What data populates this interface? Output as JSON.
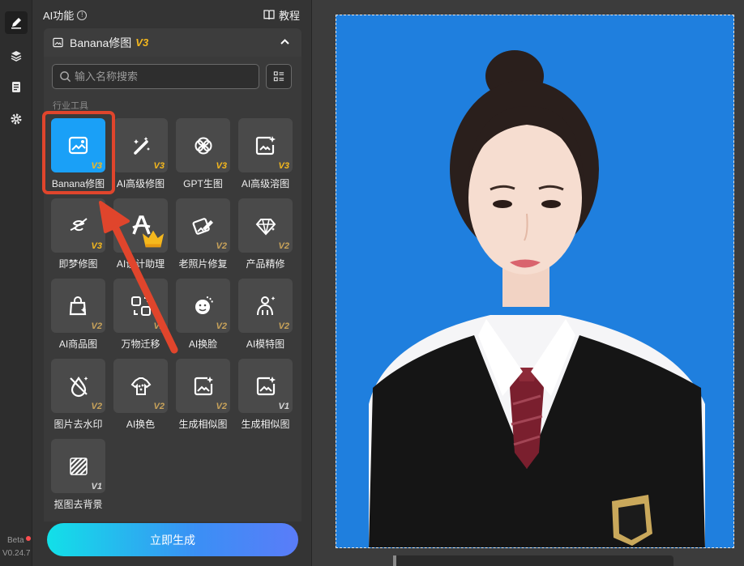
{
  "toolbar": {
    "icons": [
      "pencil-icon",
      "layers-icon",
      "clipboard-icon",
      "gear-icon"
    ],
    "beta_label": "Beta",
    "version": "V0.24.7"
  },
  "panel": {
    "ai_title": "AI功能",
    "tutorial_label": "教程",
    "dropdown": {
      "title": "Banana修图",
      "version": "V3"
    },
    "search_placeholder": "输入名称搜索",
    "section_title": "行业工具",
    "tools": [
      {
        "label": "Banana修图",
        "version": "V3",
        "icon": "image-edit-icon",
        "selected": true
      },
      {
        "label": "AI高级修图",
        "version": "V3",
        "icon": "magic-wand-icon"
      },
      {
        "label": "GPT生图",
        "version": "V3",
        "icon": "gpt-knot-icon"
      },
      {
        "label": "AI高级溶图",
        "version": "V3",
        "icon": "image-sparkle-icon"
      },
      {
        "label": "即梦修图",
        "version": "V3",
        "icon": "jimeng-icon"
      },
      {
        "label": "AI设计助理",
        "version": "",
        "icon": "letter-a-icon",
        "badge": "crown-icon"
      },
      {
        "label": "老照片修复",
        "version": "V2",
        "icon": "bandage-image-icon"
      },
      {
        "label": "产品精修",
        "version": "V2",
        "icon": "gem-icon"
      },
      {
        "label": "AI商品图",
        "version": "V2",
        "icon": "shopping-bag-icon"
      },
      {
        "label": "万物迁移",
        "version": "V2",
        "icon": "transfer-icon"
      },
      {
        "label": "AI换脸",
        "version": "V2",
        "icon": "face-swap-icon"
      },
      {
        "label": "AI模特图",
        "version": "V2",
        "icon": "model-person-icon"
      },
      {
        "label": "图片去水印",
        "version": "V2",
        "icon": "no-watermark-icon"
      },
      {
        "label": "AI换色",
        "version": "V2",
        "icon": "palette-shirt-icon"
      },
      {
        "label": "生成相似图",
        "version": "V2",
        "icon": "similar-image-icon"
      },
      {
        "label": "生成相似图",
        "version": "V1",
        "icon": "similar-image-icon"
      },
      {
        "label": "抠图去背景",
        "version": "V1",
        "icon": "hatch-cutout-icon"
      }
    ],
    "generate_label": "立即生成"
  },
  "colors": {
    "accent": "#1aa0f7",
    "highlight": "#e0452c",
    "photo_bg": "#1f7fde",
    "v3": "#f5b81d"
  }
}
